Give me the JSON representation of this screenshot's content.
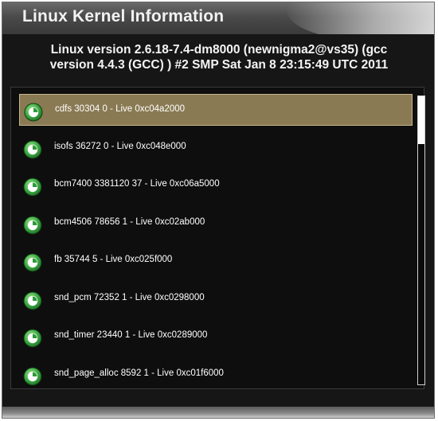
{
  "window": {
    "title": "Linux Kernel Information",
    "header_line1": "Linux version 2.6.18-7.4-dm8000 (newnigma2@vs35) (gcc",
    "header_line2": "version 4.4.3 (GCC) ) #2 SMP Sat Jan 8 23:15:49 UTC 2011"
  },
  "modules": [
    {
      "label": "cdfs 30304 0 - Live 0xc04a2000",
      "selected": true
    },
    {
      "label": "isofs 36272 0 - Live 0xc048e000",
      "selected": false
    },
    {
      "label": "bcm7400 3381120 37 - Live 0xc06a5000",
      "selected": false
    },
    {
      "label": "bcm4506 78656 1 - Live 0xc02ab000",
      "selected": false
    },
    {
      "label": "fb 35744 5 - Live 0xc025f000",
      "selected": false
    },
    {
      "label": "snd_pcm 72352 1 - Live 0xc0298000",
      "selected": false
    },
    {
      "label": "snd_timer 23440 1 - Live 0xc0289000",
      "selected": false
    },
    {
      "label": "snd_page_alloc 8592 1 - Live 0xc01f6000",
      "selected": false
    }
  ],
  "icon": "module-entry-icon",
  "colors": {
    "selection": "#8a7a53",
    "icon_green": "#2e9a3a",
    "background": "#161616"
  }
}
